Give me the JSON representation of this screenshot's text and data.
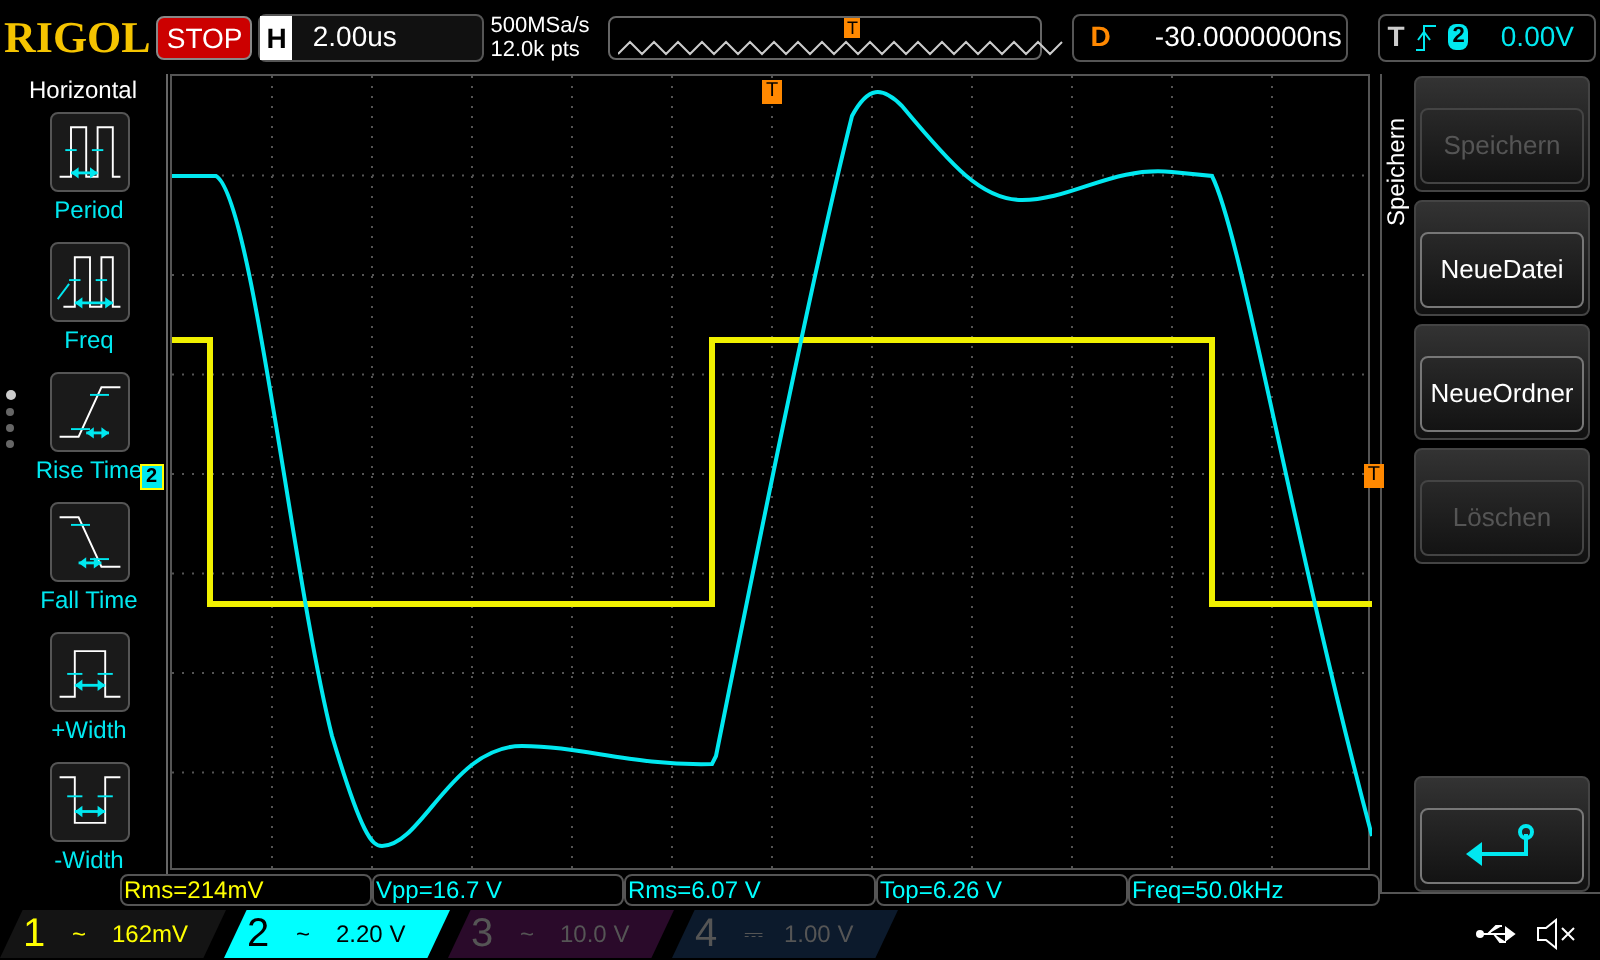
{
  "top_bar": {
    "logo": "RIGOL",
    "run_state": "STOP",
    "horizontal": {
      "label": "H",
      "value": "2.00us"
    },
    "sample_rate": "500MSa/s",
    "memory_depth": "12.0k pts",
    "trigger_marker": "T",
    "delay": {
      "label": "D",
      "value": "-30.0000000ns"
    },
    "trigger": {
      "label": "T",
      "source": "2",
      "level": "0.00V"
    }
  },
  "left_menu": {
    "title": "Horizontal",
    "items": [
      {
        "kind": "period",
        "label": "Period"
      },
      {
        "kind": "freq",
        "label": "Freq"
      },
      {
        "kind": "rise",
        "label": "Rise Time"
      },
      {
        "kind": "fall",
        "label": "Fall Time"
      },
      {
        "kind": "pwidth",
        "label": "+Width"
      },
      {
        "kind": "nwidth",
        "label": "-Width"
      }
    ],
    "pages": [
      {
        "selected": true
      },
      {
        "selected": false
      },
      {
        "selected": false
      },
      {
        "selected": false
      }
    ]
  },
  "plot": {
    "trigger_position": "T",
    "trigger_level": "T",
    "channel_marker": "2"
  },
  "right_menu": {
    "title": "Speichern",
    "buttons": [
      {
        "kind": "text",
        "label": "Speichern",
        "disabled": true
      },
      {
        "kind": "text",
        "label": "NeueDatei",
        "disabled": false
      },
      {
        "kind": "text",
        "label": "NeueOrdner",
        "disabled": false
      },
      {
        "kind": "text",
        "label": "Löschen",
        "disabled": true
      },
      {
        "kind": "back",
        "disabled": false
      }
    ]
  },
  "measurements": [
    {
      "text": "Rms=214mV",
      "color": "#ffff00"
    },
    {
      "text": "Vpp=16.7 V",
      "color": "#00ffff"
    },
    {
      "text": "Rms=6.07 V",
      "color": "#00ffff"
    },
    {
      "text": "Top=6.26 V",
      "color": "#00ffff"
    },
    {
      "text": "Freq=50.0kHz",
      "color": "#00ffff"
    }
  ],
  "channels": [
    {
      "number": "1",
      "coupling": "~",
      "scale": "162mV",
      "on": true,
      "selected": false,
      "color": "#ffff00"
    },
    {
      "number": "2",
      "coupling": "~",
      "scale": "2.20 V",
      "on": true,
      "selected": true,
      "color": "#00ffff"
    },
    {
      "number": "3",
      "coupling": "~",
      "scale": "10.0 V",
      "on": false,
      "selected": false,
      "color": "#2a0a2a"
    },
    {
      "number": "4",
      "coupling": "⎓",
      "scale": "1.00 V",
      "on": false,
      "selected": false,
      "color": "#0c1a2c"
    }
  ]
}
